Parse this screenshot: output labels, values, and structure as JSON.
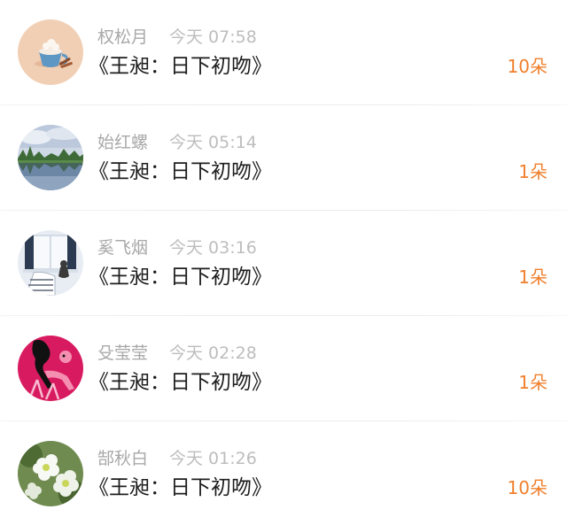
{
  "gift_list": [
    {
      "name": "权松月",
      "time": "今天 07:58",
      "title": "《王昶：日下初吻》",
      "count": "10朵",
      "avatar_icon": "latte-mug-icon"
    },
    {
      "name": "始红螺",
      "time": "今天 05:14",
      "title": "《王昶：日下初吻》",
      "count": "1朵",
      "avatar_icon": "lake-landscape-icon"
    },
    {
      "name": "奚飞烟",
      "time": "今天 03:16",
      "title": "《王昶：日下初吻》",
      "count": "1朵",
      "avatar_icon": "window-cat-icon"
    },
    {
      "name": "殳莹莹",
      "time": "今天 02:28",
      "title": "《王昶：日下初吻》",
      "count": "1朵",
      "avatar_icon": "pink-panther-icon"
    },
    {
      "name": "郜秋白",
      "time": "今天 01:26",
      "title": "《王昶：日下初吻》",
      "count": "10朵",
      "avatar_icon": "white-flowers-icon"
    }
  ],
  "colors": {
    "count": "#f07f2c",
    "name": "#a8a8a8",
    "time": "#bdbdbd",
    "title": "#1d1d1d"
  }
}
